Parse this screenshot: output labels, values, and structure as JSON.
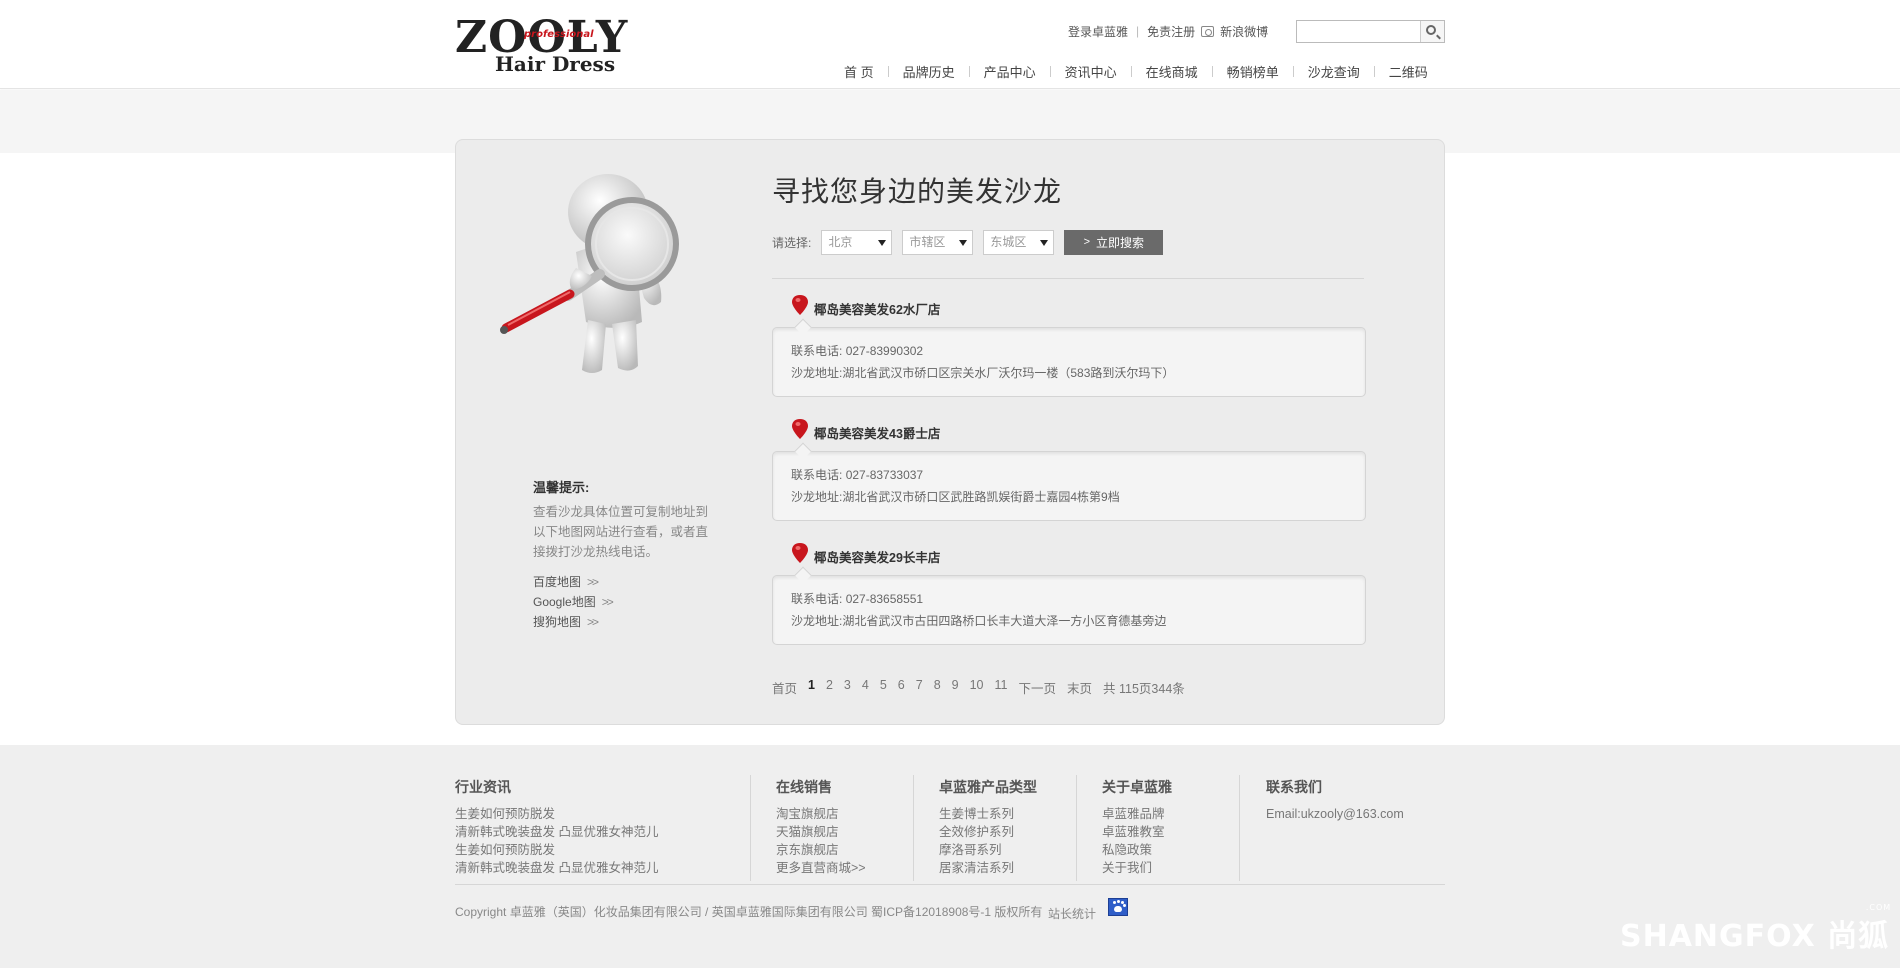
{
  "header": {
    "logo_text": "ZOOLY",
    "logo_professional": "professional",
    "logo_sub": "Hair Dress",
    "top_links": [
      "登录卓蓝雅",
      "免责注册",
      "新浪微博"
    ],
    "search_placeholder": "",
    "nav": [
      "首 页",
      "品牌历史",
      "产品中心",
      "资讯中心",
      "在线商城",
      "畅销榜单",
      "沙龙查询",
      "二维码"
    ]
  },
  "tips": {
    "title": "温馨提示:",
    "text": "查看沙龙具体位置可复制地址到以下地图网站进行查看，或者直接拨打沙龙热线电话。",
    "map_links": [
      "百度地图",
      "Google地图",
      "搜狗地图"
    ]
  },
  "main": {
    "heading": "寻找您身边的美发沙龙",
    "filter_label": "请选择:",
    "selects": [
      "北京",
      "市辖区",
      "东城区"
    ],
    "search_button": "立即搜索",
    "results": [
      {
        "name": "椰岛美容美发62水厂店",
        "phone_label": "联系电话:",
        "phone": "027-83990302",
        "address_label": "沙龙地址:",
        "address": "湖北省武汉市硚口区宗关水厂沃尔玛一楼（583路到沃尔玛下）"
      },
      {
        "name": "椰岛美容美发43爵士店",
        "phone_label": "联系电话:",
        "phone": "027-83733037",
        "address_label": "沙龙地址:",
        "address": "湖北省武汉市硚口区武胜路凯娱街爵士嘉园4栋第9档"
      },
      {
        "name": "椰岛美容美发29长丰店",
        "phone_label": "联系电话:",
        "phone": "027-83658551",
        "address_label": "沙龙地址:",
        "address": "湖北省武汉市古田四路桥口长丰大道大泽一方小区育德基旁边"
      }
    ],
    "pager": {
      "first": "首页",
      "pages": [
        "1",
        "2",
        "3",
        "4",
        "5",
        "6",
        "7",
        "8",
        "9",
        "10",
        "11"
      ],
      "current": "1",
      "next": "下一页",
      "last": "末页",
      "summary": "共 115页344条"
    }
  },
  "footer": {
    "columns": [
      {
        "title": "行业资讯",
        "links": [
          "生姜如何预防脱发",
          "清新韩式晚装盘发 凸显优雅女神范儿",
          "生姜如何预防脱发",
          "清新韩式晚装盘发 凸显优雅女神范儿"
        ]
      },
      {
        "title": "在线销售",
        "links": [
          "淘宝旗舰店",
          "天猫旗舰店",
          "京东旗舰店",
          "更多直营商城>>"
        ]
      },
      {
        "title": "卓蓝雅产品类型",
        "links": [
          "生姜博士系列",
          "全效修护系列",
          "摩洛哥系列",
          "居家清洁系列"
        ]
      },
      {
        "title": "关于卓蓝雅",
        "links": [
          "卓蓝雅品牌",
          "卓蓝雅教室",
          "私隐政策",
          "关于我们"
        ]
      },
      {
        "title": "联系我们",
        "links": [
          "Email:ukzooly@163.com"
        ]
      }
    ],
    "copyright": "Copyright 卓蓝雅（英国）化妆品集团有限公司 / 英国卓蓝雅国际集团有限公司 蜀ICP备12018908号-1 版权所有",
    "stat_link": "站长统计",
    "watermark": "SHANGFOX",
    "watermark_sub": ".COM",
    "watermark_cn": "尚狐"
  },
  "colors": {
    "accent_red": "#c8161d",
    "button_gray": "#6a6a6a",
    "panel_bg": "#ececec"
  }
}
